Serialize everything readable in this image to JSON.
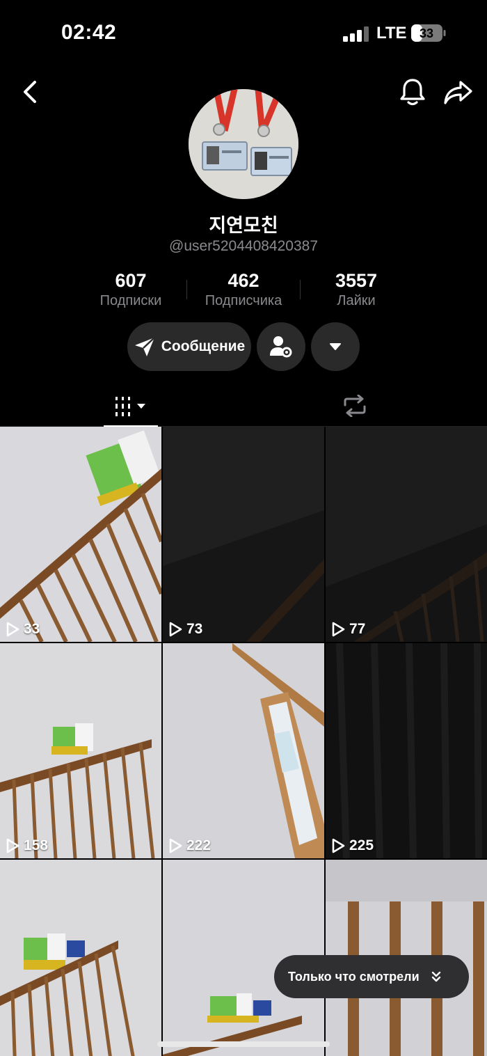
{
  "status_bar": {
    "time": "02:42",
    "network": "LTE",
    "battery": "33"
  },
  "profile": {
    "display_name": "지연모친",
    "username": "@user5204408420387",
    "avatar_icon": "profile-photo"
  },
  "stats": [
    {
      "value": "607",
      "label": "Подписки"
    },
    {
      "value": "462",
      "label": "Подписчика"
    },
    {
      "value": "3557",
      "label": "Лайки"
    }
  ],
  "actions": {
    "message_label": "Сообщение"
  },
  "videos": [
    {
      "views": "33"
    },
    {
      "views": "73"
    },
    {
      "views": "77"
    },
    {
      "views": "158"
    },
    {
      "views": "222"
    },
    {
      "views": "225"
    },
    {
      "views": ""
    },
    {
      "views": ""
    },
    {
      "views": ""
    }
  ],
  "recently_watched": {
    "label": "Только что смотрели"
  },
  "colors": {
    "background": "#000000",
    "secondary_text": "#8a8a8e",
    "button_bg": "#2a2a2a"
  }
}
